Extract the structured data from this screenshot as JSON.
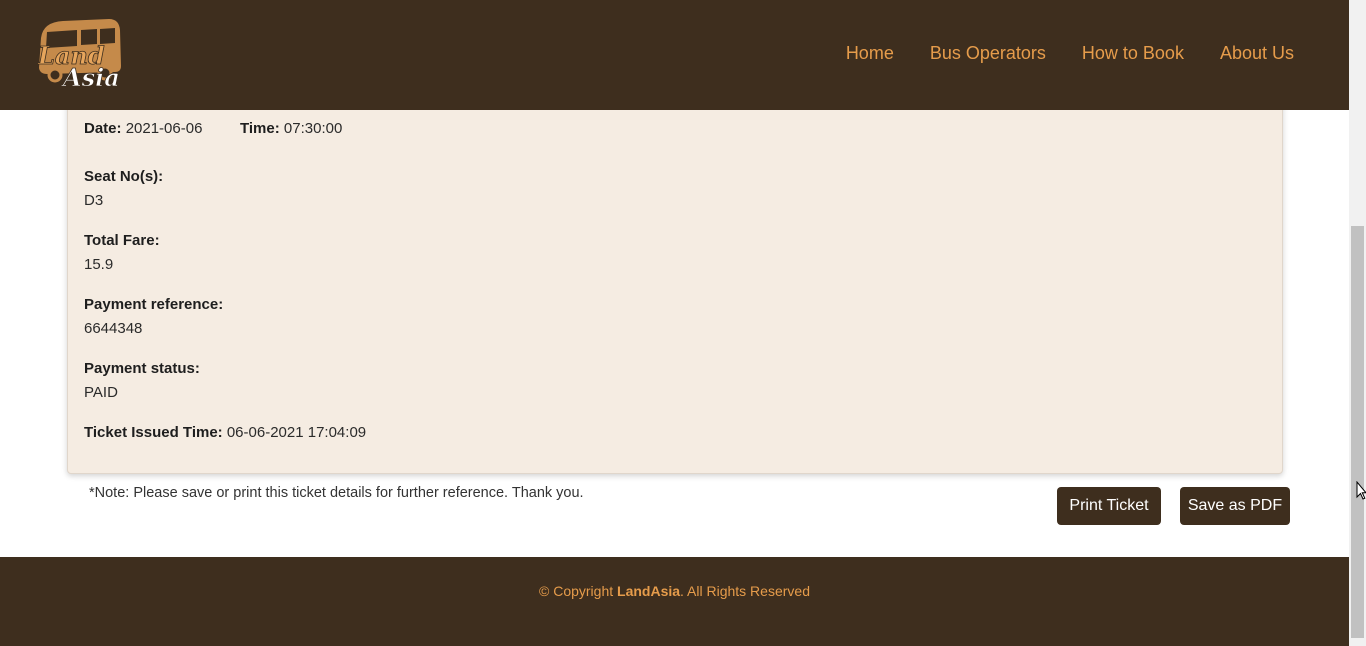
{
  "brand": {
    "name": "LandAsia",
    "logo_text_line1": "Land",
    "logo_text_line2": "Asia"
  },
  "nav": {
    "home": "Home",
    "operators": "Bus Operators",
    "how": "How to Book",
    "about": "About Us"
  },
  "ticket": {
    "date_label": "Date:",
    "date": "2021-06-06",
    "time_label": "Time:",
    "time": "07:30:00",
    "seat_label": "Seat No(s):",
    "seat": "D3",
    "fare_label": "Total Fare:",
    "fare": "15.9",
    "payref_label": "Payment reference:",
    "payref": "6644348",
    "paystatus_label": "Payment status:",
    "paystatus": "PAID",
    "issued_label": "Ticket Issued Time:",
    "issued": "06-06-2021 17:04:09"
  },
  "note": "*Note: Please save or print this ticket details for further reference. Thank you.",
  "buttons": {
    "print": "Print Ticket",
    "pdf": "Save as PDF"
  },
  "footer": {
    "prefix": "© Copyright ",
    "brand": "LandAsia",
    "suffix": ". All Rights Reserved"
  },
  "colors": {
    "header_bg": "#3e2e1e",
    "accent": "#e69c4b",
    "card_bg": "#f5ece2"
  }
}
